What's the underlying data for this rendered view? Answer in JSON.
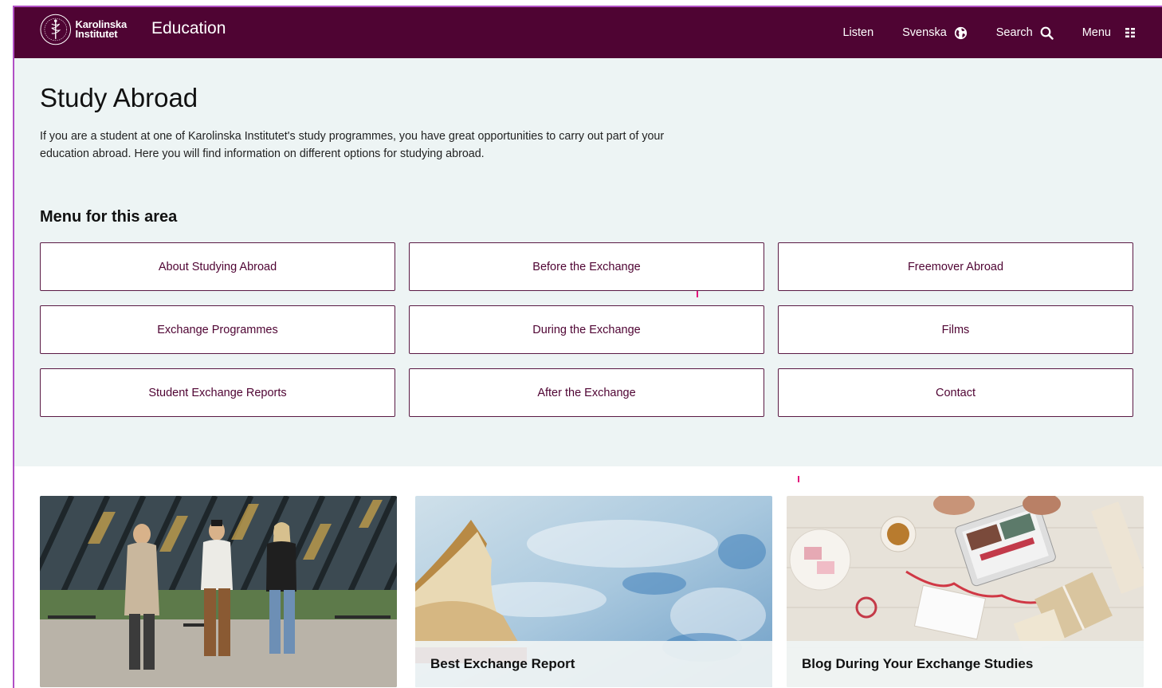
{
  "header": {
    "logo_text_line1": "Karolinska",
    "logo_text_line2": "Institutet",
    "site_title": "Education",
    "nav": {
      "listen": "Listen",
      "language": "Svenska",
      "search": "Search",
      "menu": "Menu"
    },
    "colors": {
      "brand": "#4f0433"
    }
  },
  "intro": {
    "title": "Study Abroad",
    "lead": "If you are a student at one of Karolinska Institutet's study programmes, you have great opportunities to carry out part of your education abroad. Here you will find information on different options for studying abroad.",
    "background": "#edf4f4"
  },
  "area_menu": {
    "heading": "Menu for this area",
    "items": [
      "About Studying Abroad",
      "Before the Exchange",
      "Freemover Abroad",
      "Exchange Programmes",
      "During the Exchange",
      "Films",
      "Student Exchange Reports",
      "After the Exchange",
      "Contact"
    ]
  },
  "cards": [
    {
      "label": "",
      "image": "students-walking-photo"
    },
    {
      "label": "Best Exchange Report",
      "image": "open-book-photo"
    },
    {
      "label": "Blog During Your Exchange Studies",
      "image": "desk-with-tablet-photo"
    }
  ],
  "icons": {
    "language": "globe-icon",
    "search": "search-icon",
    "menu": "grid-menu-icon"
  }
}
